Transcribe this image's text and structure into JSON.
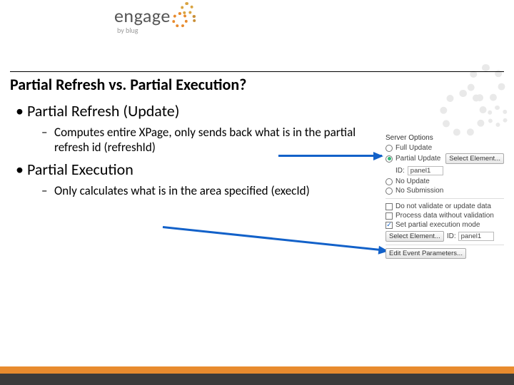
{
  "logo": {
    "word": "engage",
    "byline": "by blug"
  },
  "title": "Partial Refresh vs. Partial Execution?",
  "bullets": [
    {
      "text": "Partial Refresh (Update)",
      "sub": [
        "Computes entire XPage, only sends back what is in the partial refresh id (refreshId)"
      ]
    },
    {
      "text": "Partial Execution",
      "sub": [
        "Only calculates what is in the area specified (execId)"
      ]
    }
  ],
  "panel": {
    "title": "Server Options",
    "options": {
      "full_update": "Full Update",
      "partial_update": "Partial Update",
      "no_update": "No Update",
      "no_submission": "No Submission"
    },
    "select_element_btn": "Select Element...",
    "id_label": "ID:",
    "id_value_top": "panel1",
    "checks": {
      "no_validate": "Do not validate or update data",
      "process_without_validation": "Process data without validation",
      "set_partial_exec": "Set partial execution mode"
    },
    "id_value_bottom": "panel1",
    "edit_event_params_btn": "Edit Event Parameters..."
  }
}
